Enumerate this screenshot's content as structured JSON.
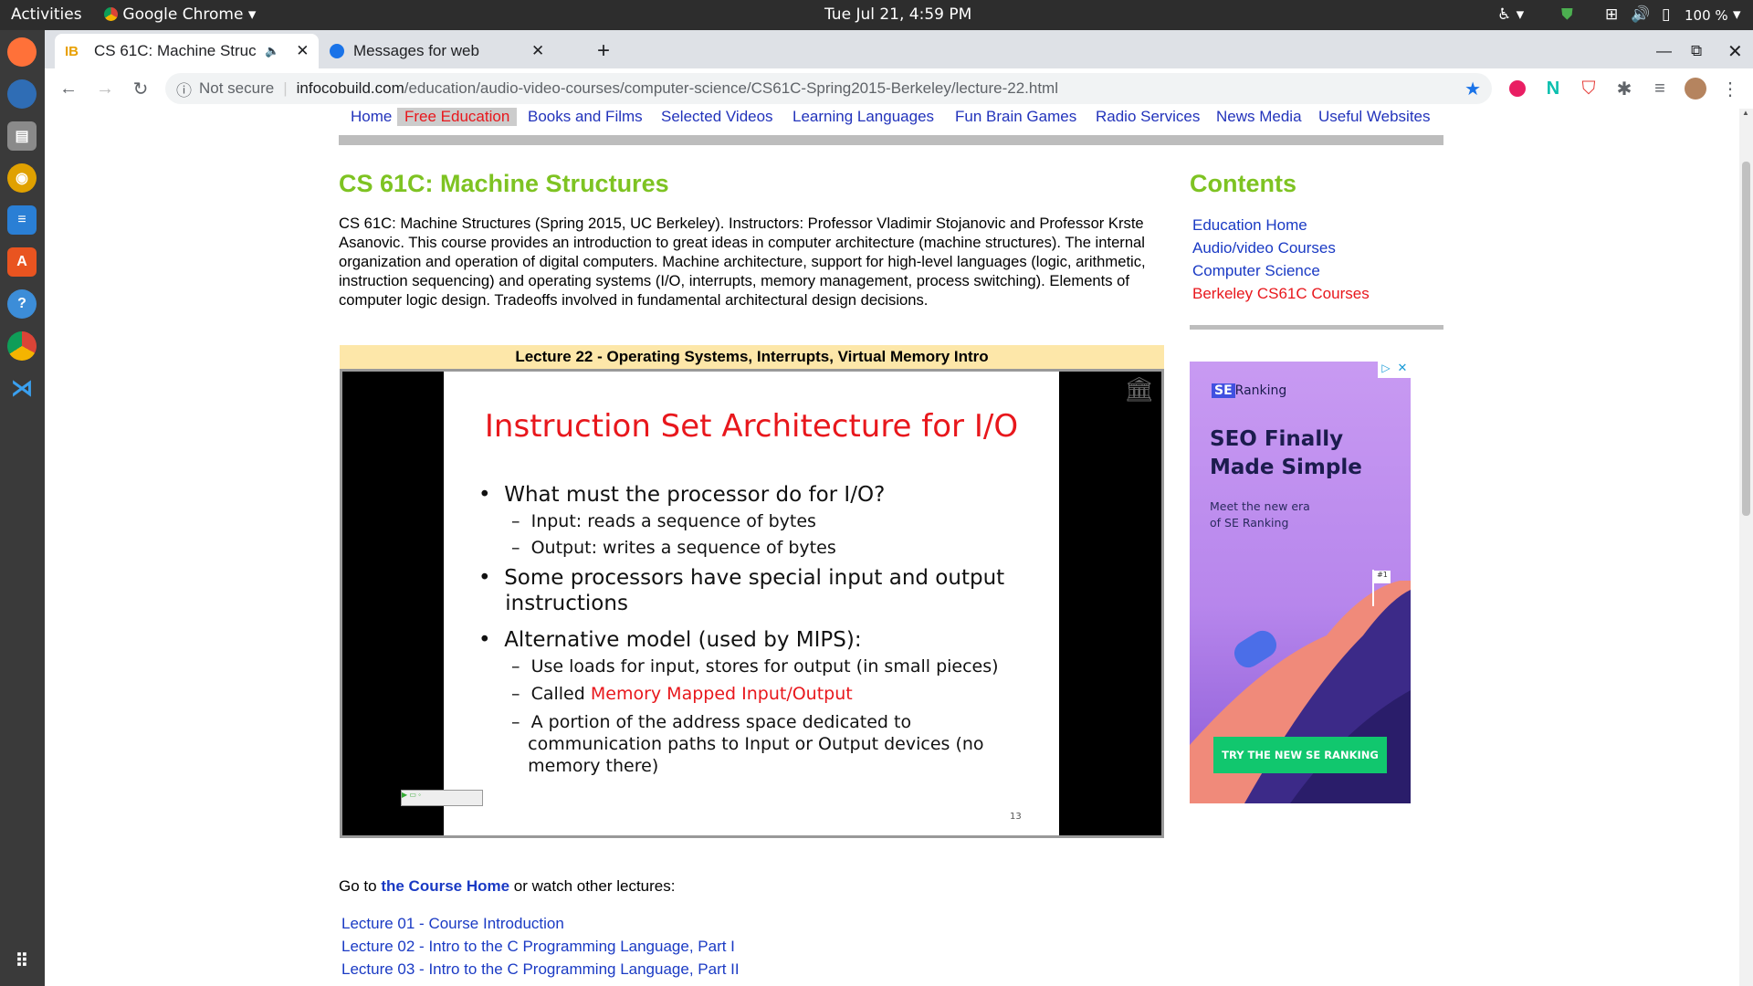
{
  "system": {
    "activities": "Activities",
    "app_name": "Google Chrome",
    "clock": "Tue Jul 21,  4:59 PM",
    "battery": "100 %"
  },
  "browser": {
    "tabs": [
      {
        "title": "CS 61C: Machine Struc",
        "favicon": "IB",
        "active": true
      },
      {
        "title": "Messages for web",
        "active": false
      }
    ],
    "security": "Not secure",
    "url_host": "infocobuild.com",
    "url_path": "/education/audio-video-courses/computer-science/CS61C-Spring2015-Berkeley/lecture-22.html"
  },
  "site_nav": [
    "Home",
    "Free Education",
    "Books and Films",
    "Selected Videos",
    "Learning Languages",
    "Fun Brain Games",
    "Radio Services",
    "News Media",
    "Useful Websites"
  ],
  "page": {
    "title": "CS 61C: Machine Structures",
    "description": "CS 61C: Machine Structures (Spring 2015, UC Berkeley). Instructors: Professor Vladimir Stojanovic and Professor Krste Asanovic. This course provides an introduction to great ideas in computer architecture (machine structures). The internal organization and operation of digital computers. Machine architecture, support for high-level languages (logic, arithmetic, instruction sequencing) and operating systems (I/O, interrupts, memory management, process switching). Elements of computer logic design. Tradeoffs involved in fundamental architectural design decisions.",
    "lecture_title": "Lecture 22 - Operating Systems, Interrupts, Virtual Memory Intro",
    "goto_prefix": "Go to ",
    "goto_link": "the Course Home",
    "goto_suffix": " or watch other lectures:",
    "lectures": [
      "Lecture 01 - Course Introduction",
      "Lecture 02 - Intro to the C Programming Language, Part I",
      "Lecture 03 - Intro to the C Programming Language, Part II"
    ]
  },
  "slide": {
    "title": "Instruction Set Architecture for I/O",
    "b1": "What must the processor do for I/O?",
    "b1_s1": "Input:    reads a sequence of bytes",
    "b1_s2": "Output: writes a sequence of bytes",
    "b2_l1": "Some processors have special input and output",
    "b2_l2": "instructions",
    "b3": "Alternative model (used by MIPS):",
    "b3_s1": "Use loads for input, stores for output (in small pieces)",
    "b3_s2_a": "Called ",
    "b3_s2_b": "Memory Mapped Input/Output",
    "b3_s3_l1": "A portion of the address space dedicated to",
    "b3_s3_l2": "communication paths to Input or Output devices (no",
    "b3_s3_l3": "memory there)",
    "page_no": "13"
  },
  "sidebar": {
    "heading": "Contents",
    "links": [
      "Education Home",
      "Audio/video Courses",
      "Computer Science",
      "Berkeley CS61C Courses"
    ]
  },
  "ad": {
    "brand_se": "SE",
    "brand_rest": "Ranking",
    "headline1": "SEO Finally",
    "headline2": "Made Simple",
    "sub1": "Meet the new era",
    "sub2": "of SE Ranking",
    "flag": "#1",
    "cta": "TRY THE NEW SE RANKING"
  },
  "colors": {
    "accent_green": "#7ec322",
    "link_blue": "#1a3ac4",
    "red": "#e8171c",
    "lecture_bar": "#fde7a9"
  }
}
